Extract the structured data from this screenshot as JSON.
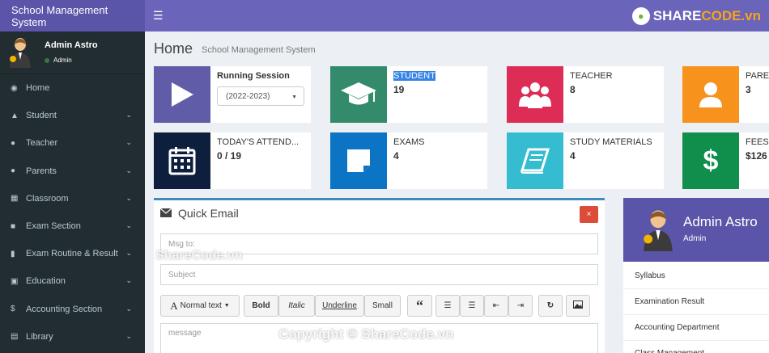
{
  "brand": "School Management System",
  "watermark": {
    "logo_a": "SHARE",
    "logo_b": "CODE.vn",
    "mid": "ShareCode.vn",
    "bottom": "Copyright © ShareCode.vn"
  },
  "user": {
    "name": "Admin Astro",
    "role": "Admin"
  },
  "menu": [
    {
      "label": "Home",
      "icon": "dashboard-icon",
      "has_children": false
    },
    {
      "label": "Student",
      "icon": "graduation-cap-icon",
      "has_children": true
    },
    {
      "label": "Teacher",
      "icon": "users-icon",
      "has_children": true
    },
    {
      "label": "Parents",
      "icon": "user-icon",
      "has_children": true
    },
    {
      "label": "Classroom",
      "icon": "grid-icon",
      "has_children": true
    },
    {
      "label": "Exam Section",
      "icon": "book-icon",
      "has_children": true
    },
    {
      "label": "Exam Routine & Result",
      "icon": "file-icon",
      "has_children": true
    },
    {
      "label": "Education",
      "icon": "book-open-icon",
      "has_children": true
    },
    {
      "label": "Accounting Section",
      "icon": "dollar-icon",
      "has_children": true
    },
    {
      "label": "Library",
      "icon": "library-icon",
      "has_children": true
    }
  ],
  "page": {
    "title": "Home",
    "subtitle": "School Management System"
  },
  "session": {
    "label": "Running Session",
    "value": "(2022-2023)"
  },
  "stats": {
    "student": {
      "label": "STUDENT",
      "value": "19"
    },
    "teacher": {
      "label": "TEACHER",
      "value": "8"
    },
    "parents": {
      "label": "PARE",
      "value": "3"
    },
    "attendance": {
      "label": "TODAY'S ATTEND...",
      "value": "0 / 19"
    },
    "exams": {
      "label": "EXAMS",
      "value": "4"
    },
    "materials": {
      "label": "STUDY MATERIALS",
      "value": "4"
    },
    "fees": {
      "label": "FEES",
      "value": "$126"
    }
  },
  "colors": {
    "session": "#605ca8",
    "student": "#338b6b",
    "teacher": "#dd2c55",
    "parents": "#f7931d",
    "attendance": "#0e1f3d",
    "exams": "#0b74c5",
    "materials": "#35bcd0",
    "fees": "#108f4c"
  },
  "quick_email": {
    "title": "Quick Email",
    "close": "×",
    "to_placeholder": "Msg to:",
    "subject_placeholder": "Subject",
    "message_placeholder": "message",
    "toolbar": {
      "normal": "Normal text",
      "bold": "Bold",
      "italic": "Italic",
      "underline": "Underline",
      "small": "Small",
      "quote": "“"
    }
  },
  "profile": {
    "name": "Admin Astro",
    "role": "Admin",
    "items": [
      "Syllabus",
      "Examination Result",
      "Accounting Department",
      "Class Management"
    ]
  }
}
